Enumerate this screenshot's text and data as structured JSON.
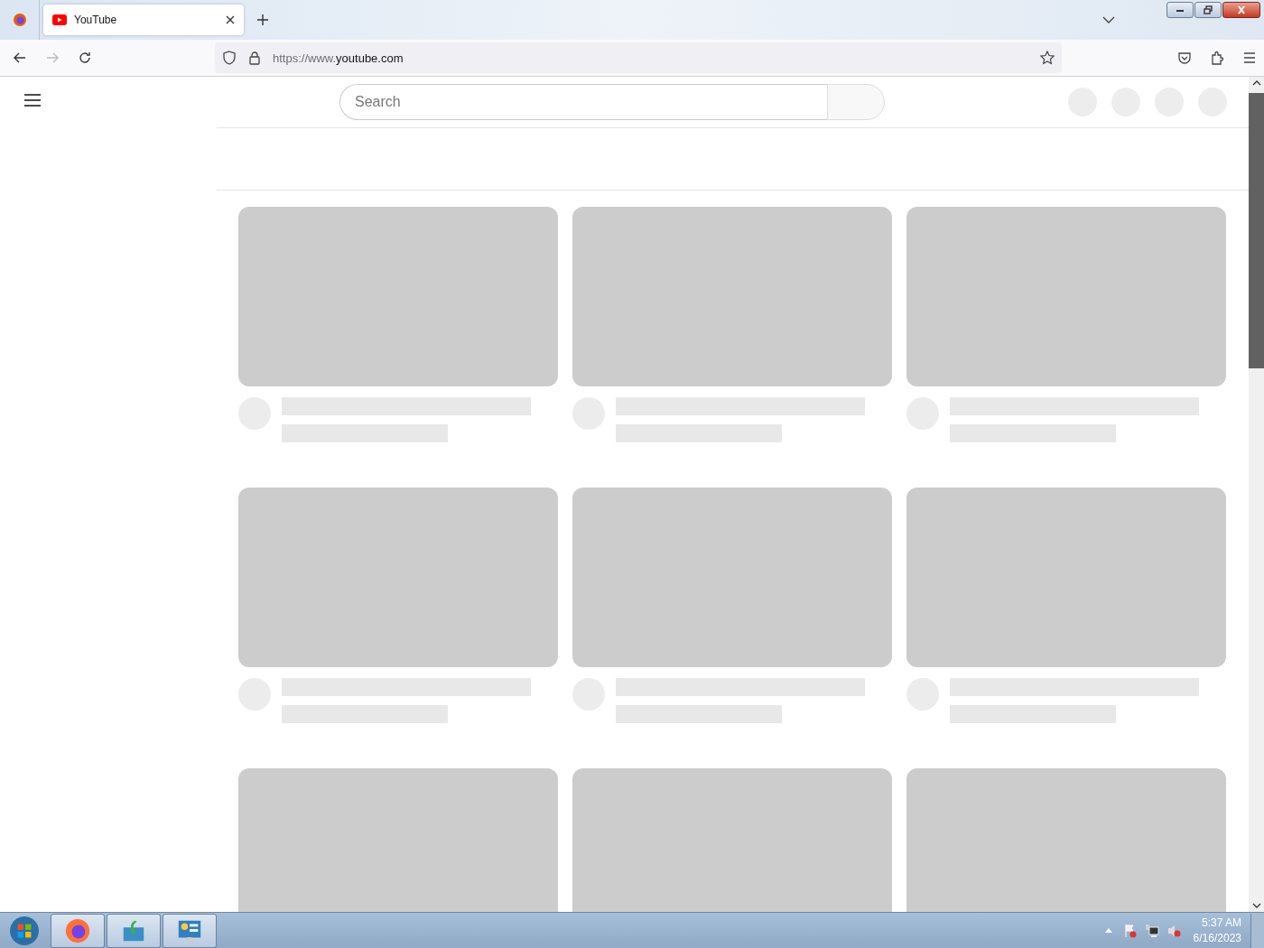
{
  "browser": {
    "tabs": [
      {
        "title": "YouTube",
        "selected": true
      }
    ],
    "address": {
      "prefix": "https://www.",
      "domain": "youtube.com"
    }
  },
  "page": {
    "search": {
      "placeholder": "Search"
    },
    "header_buttons": [
      {
        "kind": "skeleton"
      },
      {
        "kind": "skeleton"
      },
      {
        "kind": "skeleton"
      },
      {
        "kind": "skeleton"
      }
    ],
    "videos": [
      {
        "kind": "skeleton"
      },
      {
        "kind": "skeleton"
      },
      {
        "kind": "skeleton"
      },
      {
        "kind": "skeleton"
      },
      {
        "kind": "skeleton"
      },
      {
        "kind": "skeleton"
      },
      {
        "kind": "thumbnail_only"
      },
      {
        "kind": "thumbnail_only"
      },
      {
        "kind": "thumbnail_only"
      }
    ]
  },
  "taskbar": {
    "time": "5:37 AM",
    "date": "6/16/2023"
  }
}
